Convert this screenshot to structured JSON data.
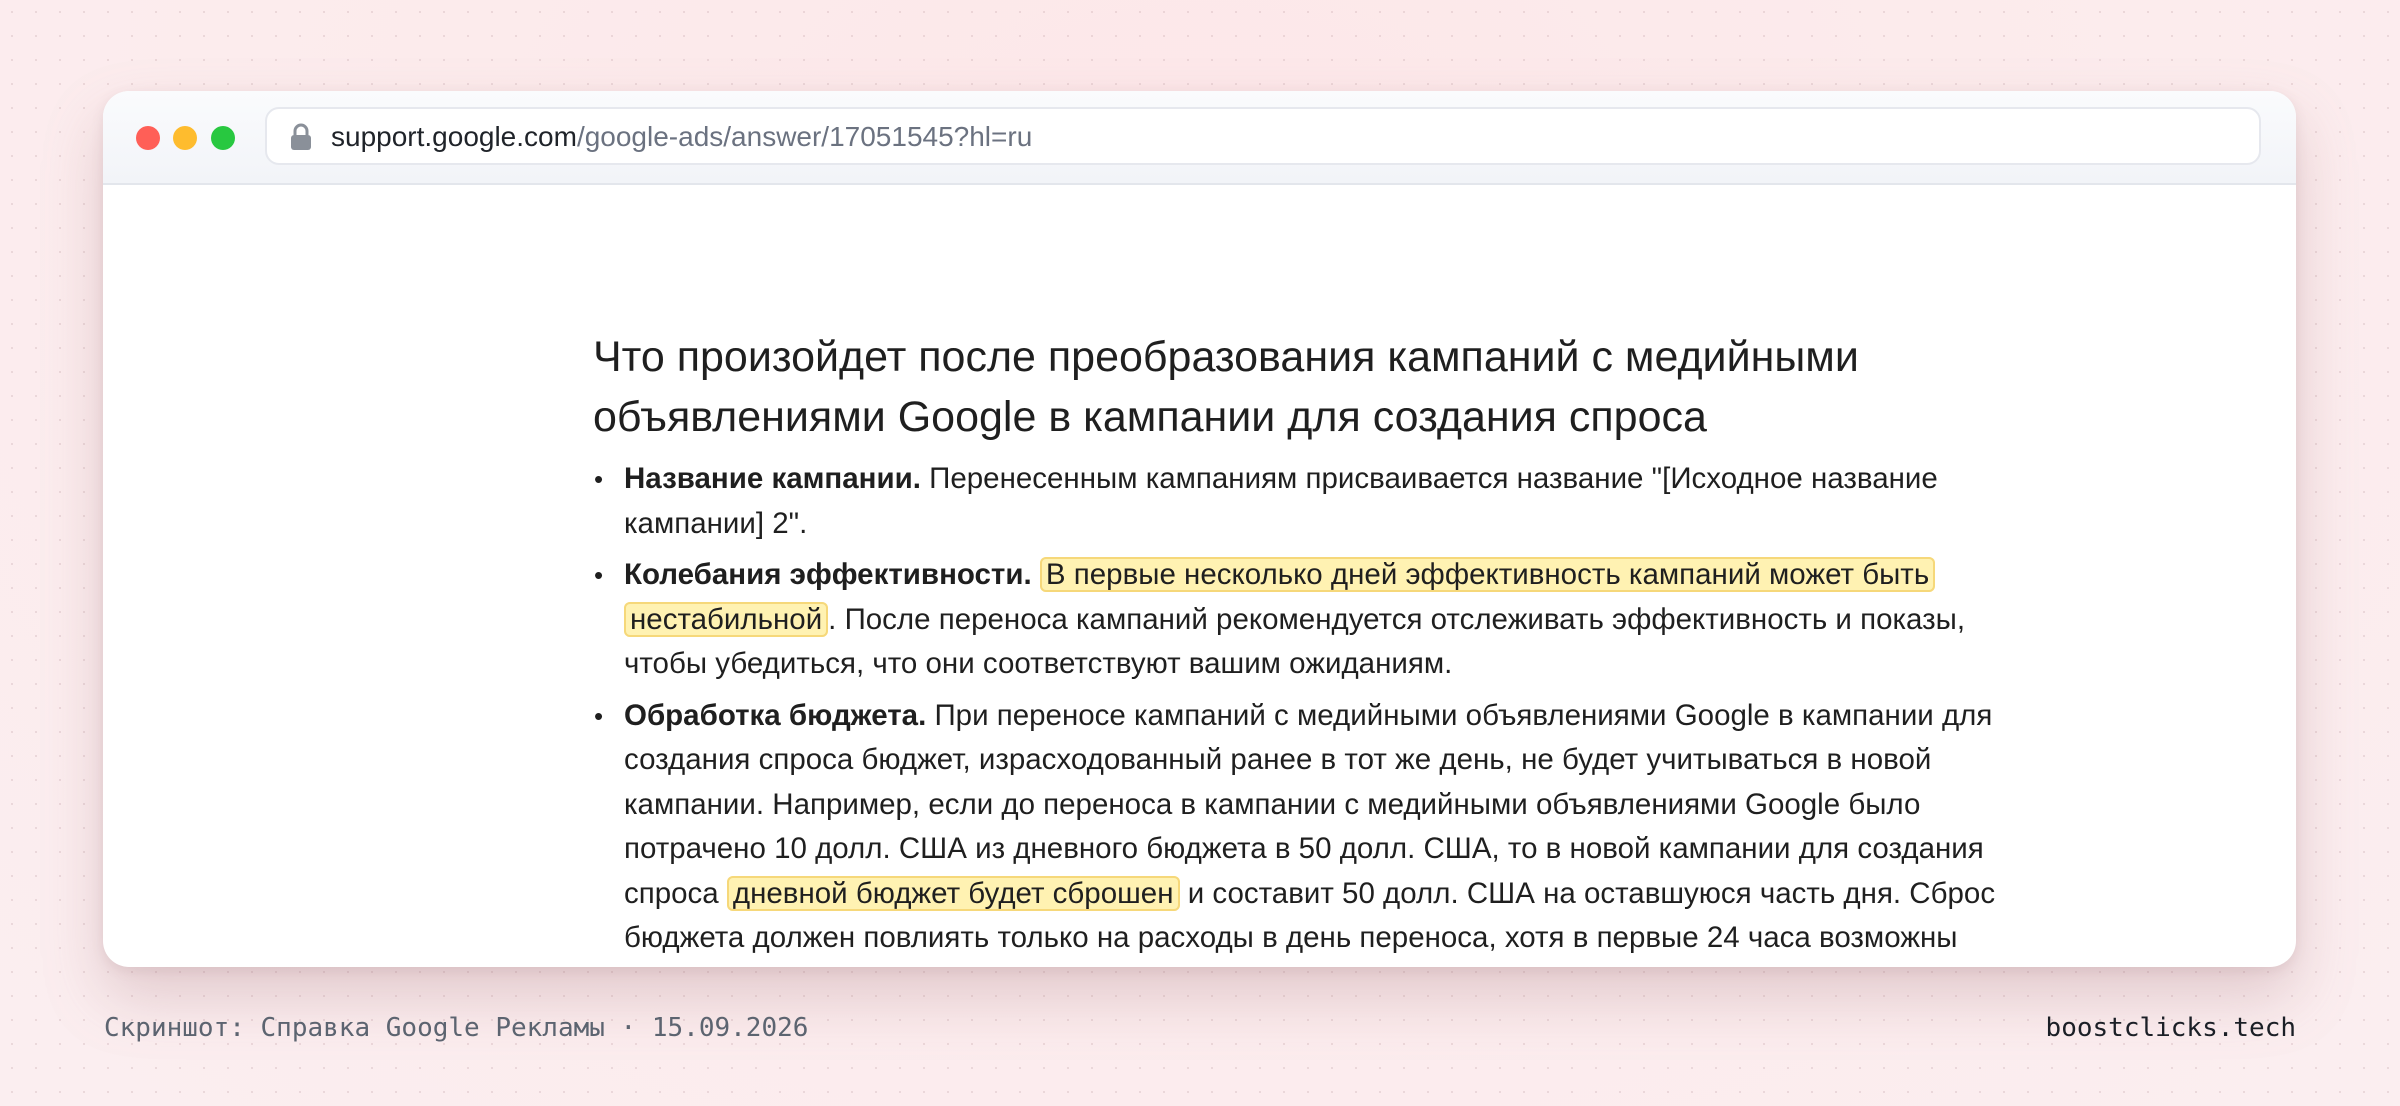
{
  "browser": {
    "url_host": "support.google.com",
    "url_path": "/google-ads/answer/17051545?hl=ru",
    "icons": {
      "lock": "lock-icon"
    }
  },
  "article": {
    "title": "Что произойдет после преобразования кампаний с медийными объявлениями Google в кампании для создания спроса",
    "items": [
      {
        "label": "Название кампании.",
        "text": " Перенесенным кампаниям присваивается название \"[Исходное название кампании] 2\"."
      },
      {
        "label": "Колебания эффективности.",
        "highlight": "В первые несколько дней эффективность кампаний может быть нестабильной",
        "text_after": ". После переноса кампаний рекомендуется отслеживать эффективность и показы, чтобы убедиться, что они соответствуют вашим ожиданиям."
      },
      {
        "label": "Обработка бюджета.",
        "text_before": " При переносе кампаний с медийными объявлениями Google в кампании для создания спроса бюджет, израсходованный ранее в тот же день, не будет учитываться в новой кампании. Например, если до переноса в кампании с медийными объявлениями Google было потрачено 10 долл. США из дневного бюджета в 50 долл. США, то в новой кампании для создания спроса ",
        "highlight": "дневной бюджет будет сброшен",
        "text_after": " и составит 50 долл. США на оставшуюся часть дня. Сброс бюджета должен повлиять только на расходы в день переноса, хотя в первые 24 часа возможны временные недорасходы или перерасходы."
      }
    ]
  },
  "footer": {
    "caption": "Скриншот: Справка Google Рекламы · 15.09.2026",
    "brand": "boostclicks.tech"
  },
  "colors": {
    "highlight_bg": "#fff2b2",
    "highlight_border": "#f6d87a",
    "traffic_red": "#ff5f57",
    "traffic_yellow": "#febc2e",
    "traffic_green": "#28c840"
  }
}
